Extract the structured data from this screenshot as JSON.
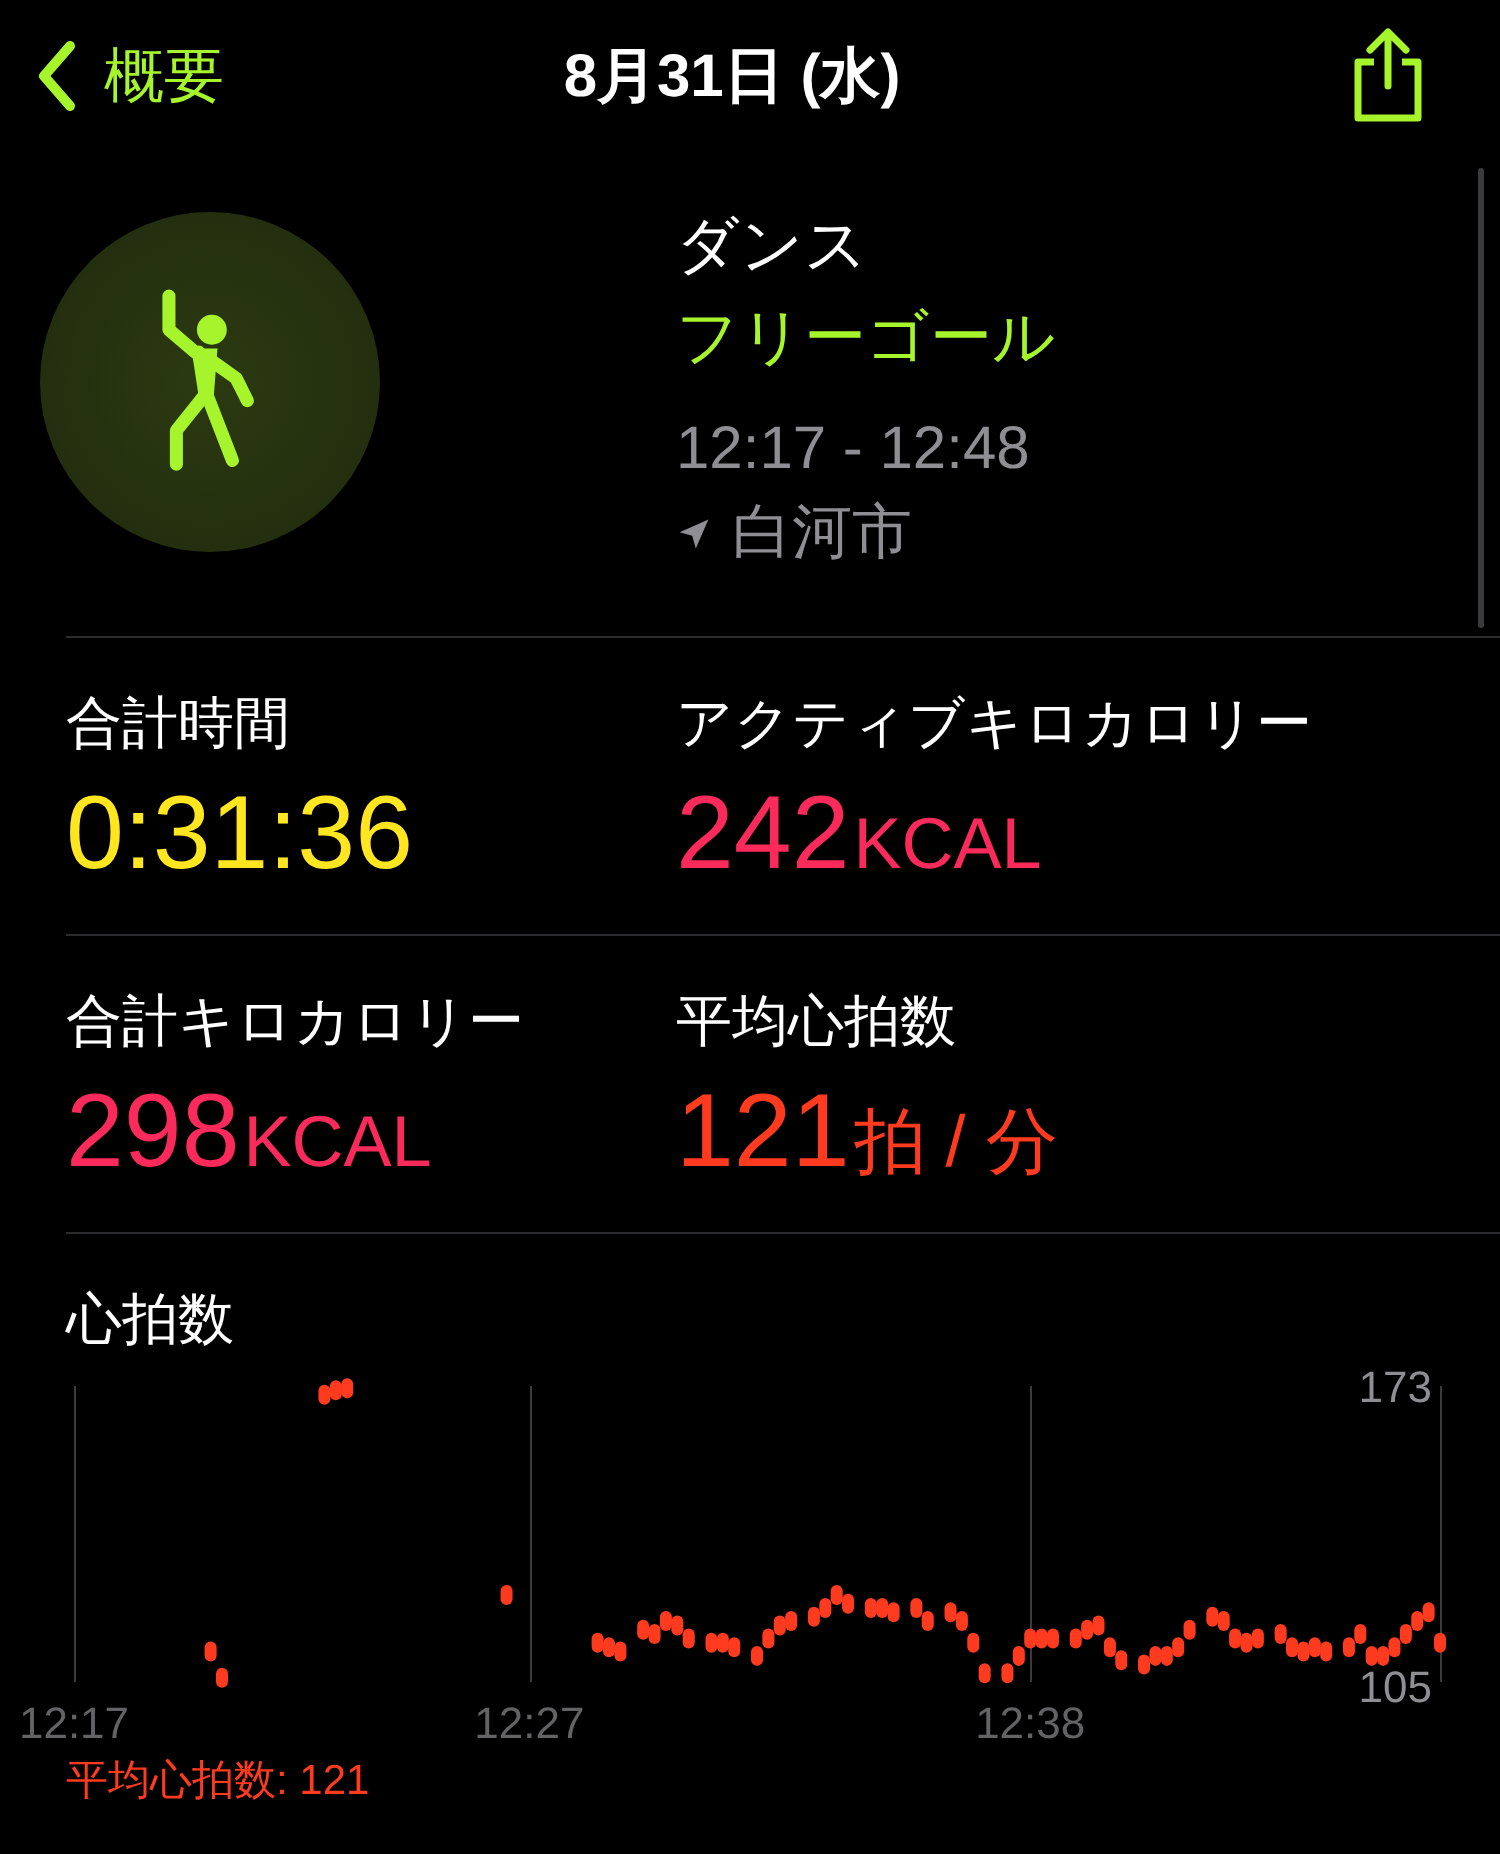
{
  "nav": {
    "back_label": "概要",
    "title": "8月31日 (水)"
  },
  "workout": {
    "name": "ダンス",
    "goal": "フリーゴール",
    "time_range": "12:17 - 12:48",
    "location": "白河市"
  },
  "metrics": [
    {
      "label": "合計時間",
      "value": "0:31:36",
      "color": "#ffe620"
    },
    {
      "label": "アクティブキロカロリー",
      "value": "242",
      "unit": "KCAL",
      "color": "#fa2a5b"
    },
    {
      "label": "合計キロカロリー",
      "value": "298",
      "unit": "KCAL",
      "color": "#fa2a5b"
    },
    {
      "label": "平均心拍数",
      "value": "121",
      "unit": "拍 / 分",
      "color": "#ff3b1f"
    }
  ],
  "heart_rate": {
    "average_label": "平均心拍数: 121",
    "chart_data": {
      "type": "scatter",
      "title": "心拍数",
      "ylim": [
        105,
        173
      ],
      "yticks": [
        105,
        173
      ],
      "categories": [
        "12:17",
        null,
        null,
        null,
        null,
        null,
        null,
        null,
        null,
        null,
        null,
        null,
        null,
        null,
        null,
        null,
        null,
        null,
        null,
        null,
        null,
        null,
        null,
        null,
        null,
        null,
        null,
        null,
        null,
        null,
        null,
        null,
        null,
        null,
        null,
        null,
        null,
        null,
        null,
        null,
        "12:27",
        null,
        null,
        null,
        null,
        null,
        null,
        null,
        null,
        null,
        null,
        null,
        null,
        null,
        null,
        null,
        null,
        null,
        null,
        null,
        null,
        null,
        null,
        null,
        null,
        null,
        null,
        null,
        null,
        null,
        null,
        null,
        null,
        null,
        null,
        null,
        null,
        null,
        null,
        null,
        null,
        null,
        null,
        null,
        "12:38",
        null,
        null,
        null,
        null,
        null,
        null,
        null,
        null,
        null,
        null,
        null,
        null,
        null,
        null,
        null,
        null,
        null,
        null,
        null,
        null,
        null,
        null,
        null,
        null,
        null,
        null,
        null,
        null,
        null,
        null,
        null,
        null,
        null,
        null,
        null,
        null
      ],
      "series": [
        {
          "color": "#ff3b1f",
          "values": [
            null,
            null,
            null,
            null,
            null,
            null,
            null,
            null,
            null,
            null,
            null,
            null,
            112,
            106,
            null,
            null,
            null,
            null,
            null,
            null,
            null,
            null,
            171,
            172,
            172.5,
            null,
            null,
            null,
            null,
            null,
            null,
            null,
            null,
            null,
            null,
            null,
            null,
            null,
            125,
            null,
            null,
            null,
            null,
            null,
            null,
            null,
            114,
            113,
            112,
            null,
            117,
            116,
            119,
            118,
            115,
            null,
            114,
            114,
            113,
            null,
            111,
            115,
            118,
            119,
            null,
            120,
            122,
            125,
            123,
            null,
            122,
            122,
            121,
            null,
            122,
            119,
            null,
            121,
            119,
            114,
            107,
            null,
            107,
            111,
            115,
            115,
            115,
            null,
            115,
            117,
            118,
            113,
            110,
            null,
            109,
            111,
            111,
            113,
            117,
            null,
            120,
            119,
            115,
            114,
            115,
            null,
            116,
            113,
            112,
            113,
            112,
            null,
            113,
            116,
            111,
            111,
            113,
            116,
            119,
            121,
            114
          ]
        }
      ]
    }
  }
}
